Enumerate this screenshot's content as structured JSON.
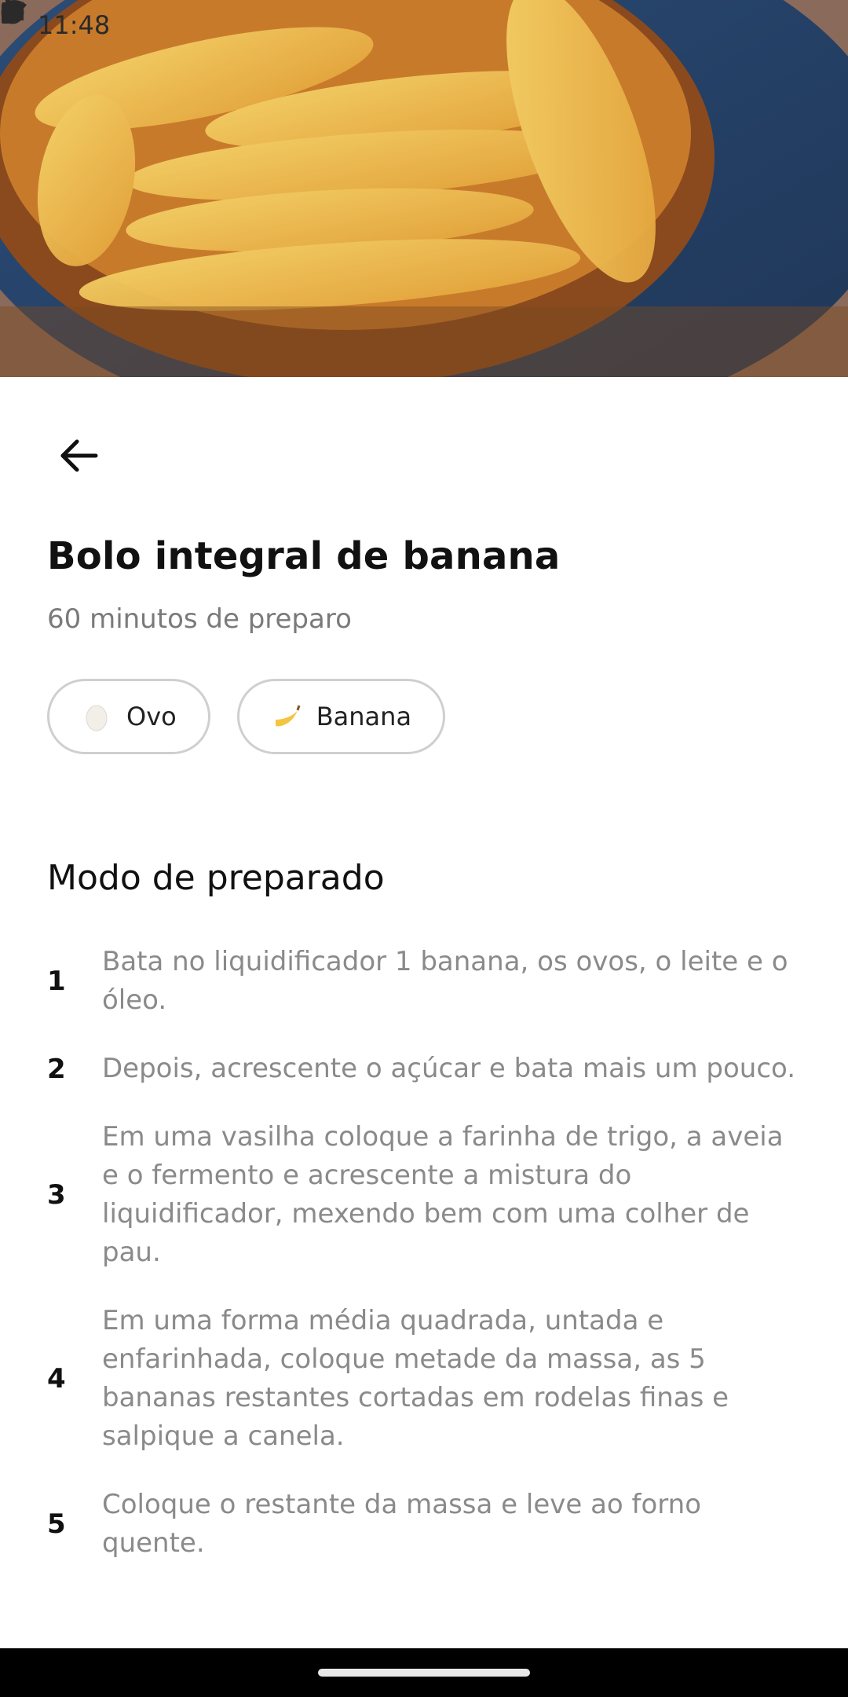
{
  "status_bar": {
    "time": "11:48",
    "left_icons": [
      "sim-card-icon",
      "face-icon"
    ],
    "right_icons": [
      "wifi-icon",
      "signal-icon",
      "battery-icon"
    ]
  },
  "hero": {
    "image": "banana-cake-photo"
  },
  "header": {
    "back_icon": "arrow-left-icon"
  },
  "recipe": {
    "title": "Bolo integral de banana",
    "subtitle": "60 minutos de preparo",
    "ingredients": [
      {
        "label": "Ovo",
        "icon": "egg-icon"
      },
      {
        "label": "Banana",
        "icon": "banana-icon"
      }
    ]
  },
  "method": {
    "title": "Modo de preparado",
    "steps": [
      {
        "number": "1",
        "text": "Bata no liquidificador 1 banana, os ovos, o leite e o óleo."
      },
      {
        "number": "2",
        "text": "Depois, acrescente o açúcar e bata mais um pouco."
      },
      {
        "number": "3",
        "text": "Em uma vasilha coloque a farinha de trigo, a aveia e o fermento e acrescente a mistura do liquidificador, mexendo bem com uma colher de pau."
      },
      {
        "number": "4",
        "text": "Em uma forma média quadrada, untada e enfarinhada, coloque metade da massa, as 5 bananas restantes cortadas em rodelas finas e salpique a canela."
      },
      {
        "number": "5",
        "text": "Coloque o restante da massa e leve ao forno quente."
      }
    ]
  },
  "colors": {
    "text_primary": "#111111",
    "text_secondary": "#7a7a7a",
    "chip_border": "#cfcfcf"
  }
}
